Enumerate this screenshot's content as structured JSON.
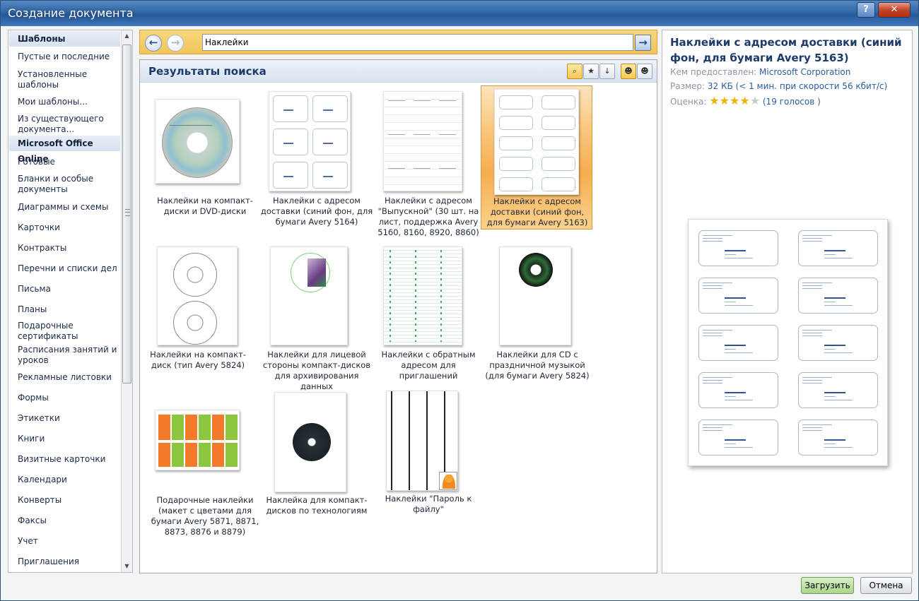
{
  "window": {
    "title": "Создание документа",
    "help_glyph": "?",
    "close_glyph": "✕"
  },
  "sidebar": {
    "header_templates": "Шаблоны",
    "items_top": [
      {
        "label": "Пустые и последние"
      },
      {
        "label": "Установленные шаблоны"
      },
      {
        "label": "Мои шаблоны..."
      },
      {
        "label": "Из существующего документа..."
      }
    ],
    "header_online": "Microsoft Office Online",
    "items_online": [
      {
        "label": "Готовые"
      },
      {
        "label": "Бланки и особые документы"
      },
      {
        "label": "Диаграммы и схемы"
      },
      {
        "label": "Карточки"
      },
      {
        "label": "Контракты"
      },
      {
        "label": "Перечни и списки дел"
      },
      {
        "label": "Письма"
      },
      {
        "label": "Планы"
      },
      {
        "label": "Подарочные сертификаты"
      },
      {
        "label": "Расписания занятий и уроков"
      },
      {
        "label": "Рекламные листовки"
      },
      {
        "label": "Формы"
      },
      {
        "label": "Этикетки"
      },
      {
        "label": "Книги"
      },
      {
        "label": "Визитные карточки"
      },
      {
        "label": "Календари"
      },
      {
        "label": "Конверты"
      },
      {
        "label": "Факсы"
      },
      {
        "label": "Учет"
      },
      {
        "label": "Приглашения"
      }
    ]
  },
  "navigation": {
    "back_glyph": "←",
    "forward_glyph": "→",
    "go_glyph": "→",
    "search_value": "Наклейки"
  },
  "results": {
    "title": "Результаты поиска",
    "items": [
      {
        "label": "Наклейки на компакт-диски и DVD-диски"
      },
      {
        "label": "Наклейки с адресом доставки (синий фон, для бумаги Avery 5164)"
      },
      {
        "label": "Наклейки с адресом \"Выпускной\" (30 шт. на лист, поддержка Avery 5160, 8160, 8920, 8860)"
      },
      {
        "label": "Наклейки с адресом доставки (синий фон, для бумаги Avery 5163)"
      },
      {
        "label": "Наклейки на компакт-диск (тип Avery 5824)"
      },
      {
        "label": "Наклейки для лицевой стороны компакт-дисков для архивирования данных"
      },
      {
        "label": "Наклейки с обратным адресом для приглашений"
      },
      {
        "label": "Наклейки для CD с праздничной музыкой (для бумаги Avery 5824)"
      },
      {
        "label": "Подарочные наклейки (макет с цветами для бумаги Avery 5871, 8871, 8873, 8876 и 8879)"
      },
      {
        "label": "Наклейка для компакт-дисков по технологиям"
      },
      {
        "label": "Наклейки \"Пароль к файлу\""
      }
    ]
  },
  "preview": {
    "title": "Наклейки с адресом доставки (синий фон, для бумаги Avery 5163)",
    "provider_label": "Кем предоставлен:",
    "provider_value": "Microsoft Corporation",
    "size_label": "Размер:",
    "size_value": "32 КБ (< 1 мин. при скорости 56 кбит/с)",
    "rating_label": "Оценка:",
    "rating_stars": 4,
    "rating_max": 5,
    "votes": "(19 голосов )"
  },
  "buttons": {
    "load": "Загрузить",
    "cancel": "Отмена"
  },
  "colors": {
    "title_bar": "#3468a9",
    "selection": "#f6ae4e",
    "accent_text": "#1d3b6a"
  }
}
